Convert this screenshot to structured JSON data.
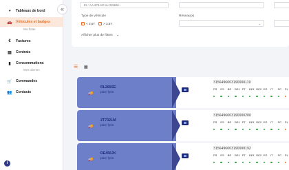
{
  "sidebar": {
    "collapse_symbol": "«",
    "items": [
      {
        "label": "Tableaux de bord",
        "icon": "dashboard-icon",
        "glyph": "◕"
      },
      {
        "label": "Véhicules et badges",
        "icon": "car-icon",
        "glyph": "🚗"
      },
      {
        "label": "Factures",
        "icon": "euro-icon",
        "glyph": "€"
      },
      {
        "label": "Contrats",
        "icon": "document-icon",
        "glyph": "▤"
      },
      {
        "label": "Consommations",
        "icon": "chart-icon",
        "glyph": "▮"
      },
      {
        "label": "Commandes",
        "icon": "cart-icon",
        "glyph": "🛒"
      },
      {
        "label": "Contacts",
        "icon": "users-icon",
        "glyph": "👥"
      }
    ],
    "sub_fleet": "Ma flotte",
    "sub_alerts": "Mes alertes",
    "info_glyph": "i"
  },
  "filters": {
    "search_placeholder": "Ex : AA-876-HG ou 315646...",
    "vehicle_type_label": "Type de véhicule",
    "checkbox_1": "< 3,5T",
    "checkbox_2": "> 3,5T",
    "network_label": "Réseau(x)",
    "more_filters": "Afficher plus de filtres",
    "chevron": "⌄"
  },
  "view": {
    "list_glyph": "☰",
    "grid_glyph": "▦"
  },
  "countries": [
    "FR",
    "ES",
    "BE",
    "BE1",
    "PT",
    "DE1",
    "DE2",
    "EG",
    "IT",
    "SC",
    "PL"
  ],
  "cards": [
    {
      "plate": "RL265SE",
      "fleet": "parc lyon",
      "number": "3156496003190000119"
    },
    {
      "plate": "ZT732LM",
      "fleet": "parc lyon",
      "number": "3156496003190000200"
    },
    {
      "plate": "DE456JK",
      "fleet": "parc lyon",
      "number": "3156496003190000192"
    }
  ],
  "colors": {
    "accent": "#e8712a",
    "card_primary": "#6d7fc9",
    "card_dark": "#3d4791",
    "status_ok": "#2ea043"
  }
}
